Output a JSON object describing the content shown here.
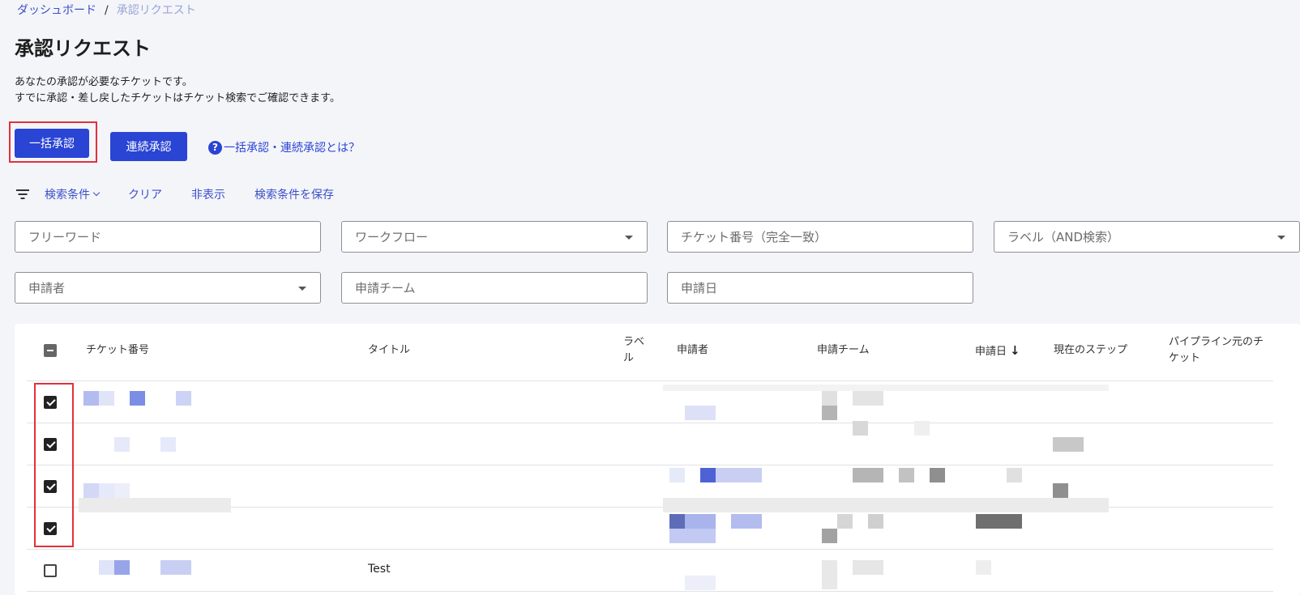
{
  "breadcrumb": {
    "home": "ダッシュボード",
    "separator": "/",
    "current": "承認リクエスト"
  },
  "page": {
    "title": "承認リクエスト",
    "desc_line1": "あなたの承認が必要なチケットです。",
    "desc_line2": "すでに承認・差し戻したチケットはチケット検索でご確認できます。"
  },
  "actions": {
    "bulk_approve": "一括承認",
    "continuous_approve": "連続承認",
    "help_icon": "?",
    "help_link": "一括承認・連続承認とは？"
  },
  "filters": {
    "conditions": "検索条件",
    "clear": "クリア",
    "hide": "非表示",
    "save": "検索条件を保存",
    "freeword": "フリーワード",
    "workflow": "ワークフロー",
    "ticket_number": "チケット番号（完全一致）",
    "label": "ラベル（AND検索）",
    "applicant": "申請者",
    "applicant_team": "申請チーム",
    "applied_date": "申請日"
  },
  "table": {
    "headers": {
      "ticket_number": "チケット番号",
      "title": "タイトル",
      "label_line1": "ラベ",
      "label_line2": "ル",
      "applicant": "申請者",
      "team": "申請チーム",
      "date": "申請日",
      "date_sort": "↓",
      "step": "現在のステップ",
      "pipeline_line1": "パイプライン元のチ",
      "pipeline_line2": "ケット"
    },
    "rows": [
      {
        "checked": true,
        "title": ""
      },
      {
        "checked": true,
        "title": ""
      },
      {
        "checked": true,
        "title": ""
      },
      {
        "checked": true,
        "title": ""
      },
      {
        "checked": false,
        "title": "Test"
      }
    ]
  },
  "colors": {
    "primary": "#2a44d4",
    "highlight": "#e3303a",
    "background": "#f4f5f9"
  }
}
